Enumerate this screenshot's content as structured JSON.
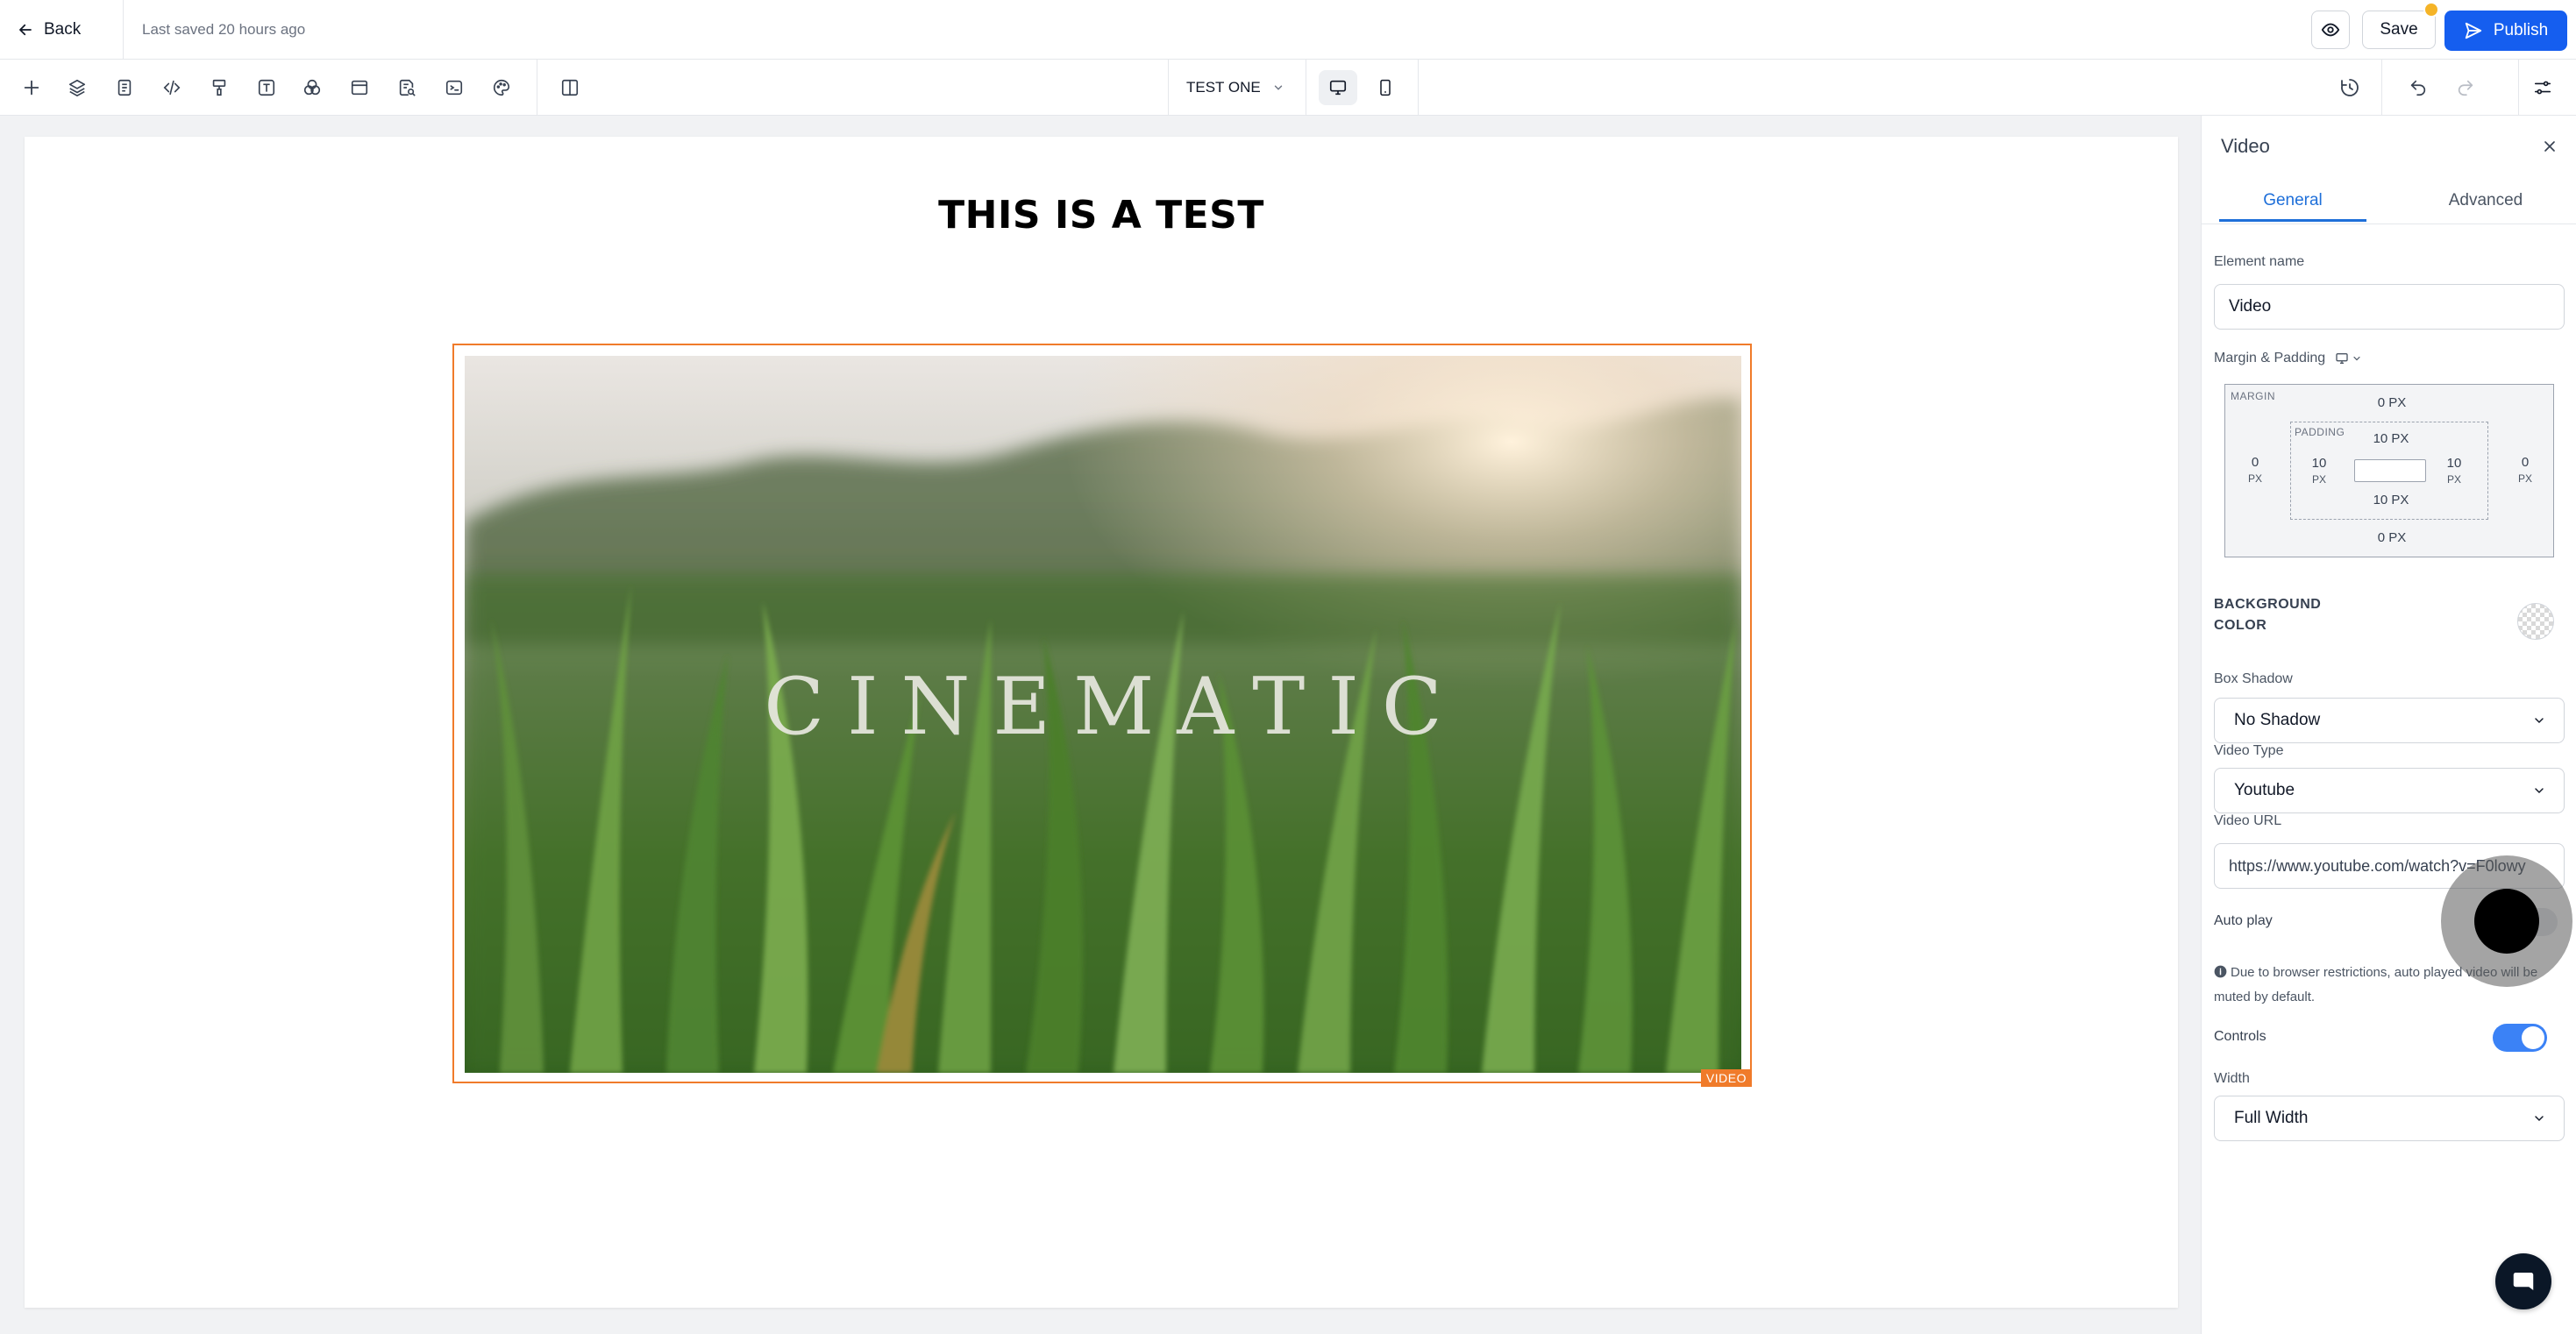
{
  "header": {
    "back_label": "Back",
    "saved_status": "Last saved 20 hours ago",
    "save_label": "Save",
    "publish_label": "Publish",
    "accent_color": "#155eef"
  },
  "toolbar": {
    "tools": [
      "add-icon",
      "layers-icon",
      "pages-icon",
      "code-icon",
      "paint-roller-icon",
      "text-icon",
      "color-circles-icon",
      "section-icon",
      "search-document-icon",
      "terminal-icon",
      "palette-icon",
      "split-view-icon"
    ],
    "page_name": "TEST ONE",
    "devices": [
      "desktop-icon",
      "mobile-icon"
    ],
    "right_tools": [
      "history-icon",
      "undo-icon",
      "redo-icon",
      "settings-sliders-icon"
    ]
  },
  "canvas": {
    "heading": "THIS IS A TEST",
    "video_overlay_text": "CINEMATIC",
    "video_tag": "VIDEO",
    "selection_color": "#f07b2a"
  },
  "panel": {
    "title": "Video",
    "tabs": [
      {
        "label": "General",
        "active": true
      },
      {
        "label": "Advanced",
        "active": false
      }
    ],
    "element_name_label": "Element name",
    "element_name_value": "Video",
    "margin_padding_label": "Margin & Padding",
    "margin": {
      "label": "MARGIN",
      "top": "0 PX",
      "bottom": "0 PX",
      "left_value": "0",
      "right_value": "0",
      "unit": "PX"
    },
    "padding": {
      "label": "PADDING",
      "top": "10 PX",
      "bottom": "10 PX",
      "left_value": "10",
      "right_value": "10",
      "unit": "PX"
    },
    "background_color_label_line1": "BACKGROUND",
    "background_color_label_line2": "COLOR",
    "box_shadow_label": "Box Shadow",
    "box_shadow_value": "No Shadow",
    "video_type_label": "Video Type",
    "video_type_value": "Youtube",
    "video_url_label": "Video URL",
    "video_url_value": "https://www.youtube.com/watch?v=F0lowy",
    "autoplay_label": "Auto play",
    "autoplay_on": false,
    "autoplay_note": "Due to browser restrictions, auto played video will be muted by default.",
    "controls_label": "Controls",
    "controls_on": true,
    "width_label": "Width",
    "width_value": "Full Width",
    "toggle_on_color": "#3b82f6"
  }
}
